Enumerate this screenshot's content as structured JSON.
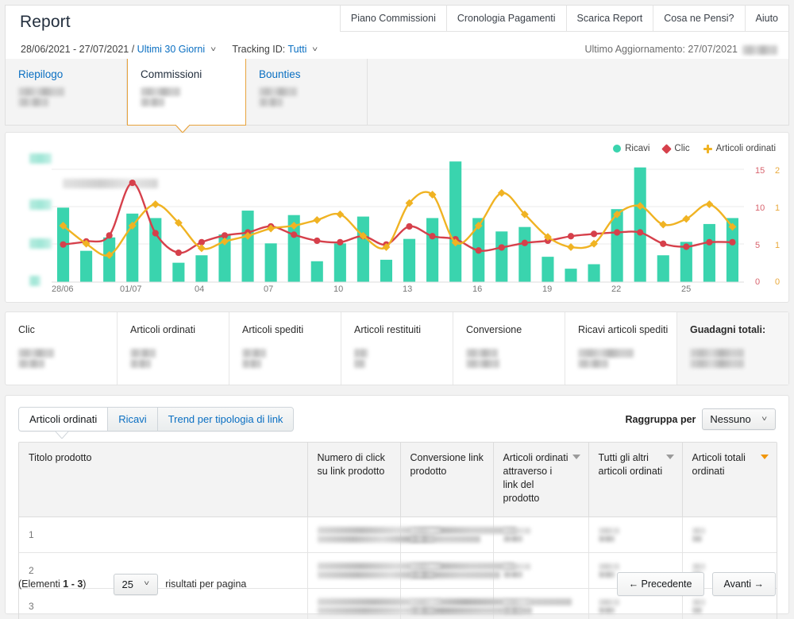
{
  "header": {
    "title": "Report",
    "date_range": "28/06/2021 - 27/07/2021 /",
    "range_preset": "Ultimi 30 Giorni",
    "tracking_label": "Tracking ID:",
    "tracking_value": "Tutti",
    "last_update": "Ultimo Aggiornamento: 27/07/2021",
    "nav": [
      {
        "label": "Piano Commissioni"
      },
      {
        "label": "Cronologia Pagamenti"
      },
      {
        "label": "Scarica Report"
      },
      {
        "label": "Cosa ne Pensi?"
      },
      {
        "label": "Aiuto"
      }
    ]
  },
  "tabs": [
    {
      "label": "Riepilogo",
      "active": false
    },
    {
      "label": "Commissioni",
      "active": true
    },
    {
      "label": "Bounties",
      "active": false
    }
  ],
  "chart_data": {
    "type": "bar",
    "title": "",
    "xlabel": "",
    "ylabel": "",
    "grid": true,
    "legend_position": "top-right",
    "categories": [
      "28/06",
      "29/06",
      "30/06",
      "01/07",
      "02/07",
      "03/07",
      "04/07",
      "05/07",
      "06/07",
      "07/07",
      "08/07",
      "09/07",
      "10/07",
      "11/07",
      "12/07",
      "13/07",
      "14/07",
      "15/07",
      "16/07",
      "17/07",
      "18/07",
      "19/07",
      "20/07",
      "21/07",
      "22/07",
      "23/07",
      "24/07",
      "25/07",
      "26/07",
      "27/07"
    ],
    "tick_labels": [
      "28/06",
      "01/07",
      "04",
      "07",
      "10",
      "13",
      "16",
      "19",
      "22",
      "25"
    ],
    "axes": {
      "left": {
        "name": "Ricavi",
        "color": "#3ad4ae",
        "ticks_redacted": true,
        "ticks": [
          "",
          "",
          "",
          ""
        ]
      },
      "right_1": {
        "name": "Clic",
        "color": "#d8646e",
        "ticks": [
          "15",
          "10",
          "5",
          "0"
        ],
        "range": [
          0,
          15
        ]
      },
      "right_2": {
        "name": "Articoli ordinati",
        "color": "#e9a93b",
        "ticks": [
          "2",
          "1",
          "1",
          "0"
        ],
        "range": [
          0,
          2
        ]
      }
    },
    "series": [
      {
        "name": "Ricavi",
        "type": "bar",
        "color": "#3ad4ae",
        "axis": "left",
        "values": [
          5.0,
          2.1,
          3.0,
          4.6,
          4.3,
          1.3,
          1.8,
          3.2,
          4.8,
          2.6,
          4.5,
          1.4,
          2.6,
          4.4,
          1.5,
          2.9,
          4.3,
          8.1,
          4.3,
          3.4,
          3.7,
          1.7,
          0.9,
          1.2,
          4.9,
          7.7,
          1.8,
          2.7,
          3.9,
          4.3
        ]
      },
      {
        "name": "Clic",
        "type": "line",
        "color": "#d6404b",
        "axis": "right_1",
        "values": [
          5.0,
          5.4,
          6.2,
          13.2,
          6.5,
          3.9,
          5.3,
          6.2,
          6.6,
          7.4,
          6.3,
          5.5,
          5.3,
          6.1,
          5.0,
          7.4,
          6.1,
          5.7,
          4.2,
          4.6,
          5.2,
          5.5,
          6.1,
          6.4,
          6.6,
          6.6,
          5.1,
          4.7,
          5.3,
          5.3
        ]
      },
      {
        "name": "Articoli ordinati",
        "type": "line",
        "color": "#f0b323",
        "axis": "right_2",
        "values": [
          1.0,
          0.68,
          0.48,
          1.0,
          1.38,
          1.05,
          0.6,
          0.72,
          0.82,
          0.95,
          1.0,
          1.1,
          1.2,
          0.82,
          0.62,
          1.4,
          1.55,
          0.7,
          1.0,
          1.58,
          1.2,
          0.8,
          0.62,
          0.68,
          1.2,
          1.35,
          1.02,
          1.12,
          1.38,
          0.98
        ]
      }
    ]
  },
  "metrics": [
    {
      "label": "Clic",
      "highlight": false
    },
    {
      "label": "Articoli ordinati",
      "highlight": false
    },
    {
      "label": "Articoli spediti",
      "highlight": false
    },
    {
      "label": "Articoli restituiti",
      "highlight": false
    },
    {
      "label": "Conversione",
      "highlight": false
    },
    {
      "label": "Ricavi articoli spediti",
      "highlight": false
    },
    {
      "label": "Guadagni totali:",
      "highlight": true
    }
  ],
  "bottom": {
    "tabs": [
      {
        "label": "Articoli ordinati",
        "active": true
      },
      {
        "label": "Ricavi",
        "active": false
      },
      {
        "label": "Trend per tipologia di link",
        "active": false
      }
    ],
    "groupby_label": "Raggruppa per",
    "groupby_value": "Nessuno",
    "columns": [
      {
        "label": "Titolo prodotto",
        "sortable": false,
        "sort_active": false
      },
      {
        "label": "Numero di click su link prodotto",
        "sortable": false,
        "sort_active": false
      },
      {
        "label": "Conversione link prodotto",
        "sortable": false,
        "sort_active": false
      },
      {
        "label": "Articoli ordinati attraverso i link del prodotto",
        "sortable": true,
        "sort_active": false
      },
      {
        "label": "Tutti gli altri articoli ordinati",
        "sortable": true,
        "sort_active": false
      },
      {
        "label": "Articoli totali ordinati",
        "sortable": true,
        "sort_active": true
      }
    ],
    "rows": [
      {
        "index": "1"
      },
      {
        "index": "2"
      },
      {
        "index": "3"
      }
    ],
    "footer": {
      "elements_prefix": "(Elementi ",
      "elements_range": "1 - 3",
      "elements_suffix": ")",
      "per_page_value": "25",
      "per_page_label": "risultati per pagina",
      "prev_label": "← Precedente",
      "next_label": "Avanti →"
    }
  },
  "colors": {
    "accent_orange": "#e8a33d",
    "link_blue": "#0a6fc2",
    "revenue_teal": "#3ad4ae",
    "clicks_red": "#d6404b",
    "orders_yellow": "#f0b323"
  }
}
